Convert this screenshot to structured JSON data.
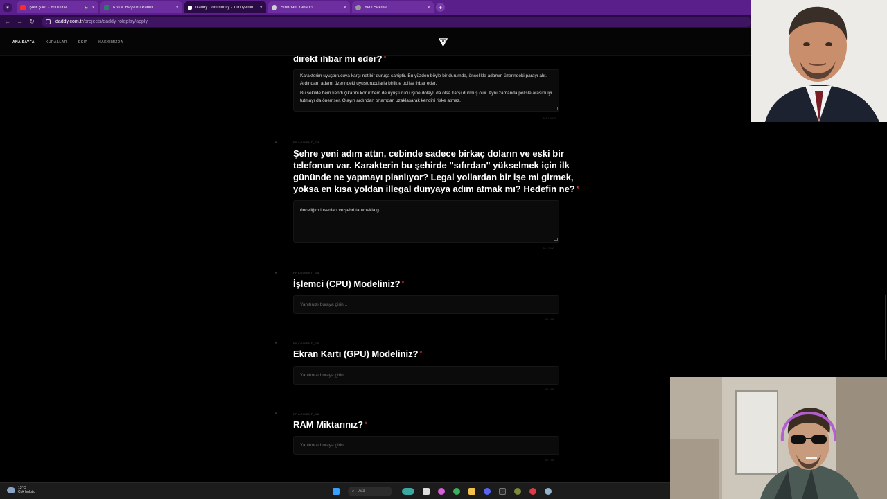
{
  "browser": {
    "tabs": [
      {
        "title": "Şikir Şıkır - YouTube",
        "fav_color": "#ff2b2b",
        "audio": true
      },
      {
        "title": "KNGL Başvuru Paneli",
        "fav_color": "#2e7d6a",
        "audio": false
      },
      {
        "title": "Daddy Community - Türkiye'nin",
        "fav_color": "#ffffff",
        "audio": false
      },
      {
        "title": "Sınırdaki Yabancı",
        "fav_color": "#cfcfcf",
        "audio": false
      },
      {
        "title": "Yeni Sekme",
        "fav_color": "#9a9a9a",
        "audio": false
      }
    ],
    "active_tab": 2,
    "url_host": "daddy.com.tr",
    "url_path": "/projects/daddy-roleplay/apply"
  },
  "site": {
    "nav": [
      "ANA SAYFA",
      "KURALLAR",
      "EKİP",
      "HAKKIMIZDA"
    ],
    "active_nav": 0
  },
  "form": {
    "q_prev_title_tail": "direkt ihbar mı eder?",
    "q_prev_answer_p1": "Karakterim uyuşturucuya karşı net bir duruşa sahiptir. Bu yüzden böyle bir durumda, öncelikle adamın üzerindeki parayı alır. Ardından, adamı üzerindeki uyuşturucularla birlikte polise ihbar eder.",
    "q_prev_answer_p2": "Bu şekilde hem kendi çıkarını korur hem de uyuşturucu işine dolaylı da olsa karşı durmuş olur. Aynı zamanda polisle arasını iyi tutmayı da önemser. Olayın ardından ortamdan uzaklaşarak kendini riske atmaz.",
    "q_prev_counter": "361 / 1000",
    "q13_fragment": "FRAGMENT_13",
    "q13_title": "Şehre yeni adım attın, cebinde sadece birkaç doların ve eski bir telefonun var. Karakterin bu şehirde \"sıfırdan\" yükselmek için ilk gününde ne yapmayı planlıyor? Legal yollardan bir işe mi girmek, yoksa en kısa yoldan illegal dünyaya adım atmak mı? Hedefin ne?",
    "q13_answer": "önceliğim insanları ve şehri tanımakla g",
    "q13_counter": "40 / 1000",
    "q14_fragment": "FRAGMENT_14",
    "q14_title": "İşlemci (CPU) Modeliniz?",
    "q15_fragment": "FRAGMENT_15",
    "q15_title": "Ekran Kartı (GPU) Modeliniz?",
    "q16_fragment": "FRAGMENT_16",
    "q16_title": "RAM Miktarınız?",
    "placeholder": "Yanıtınızı buraya girin...",
    "short_counter": "0 / 100",
    "required_mark": "*"
  },
  "taskbar": {
    "temp": "13°C",
    "condition": "Çok bulutlu",
    "search_label": "Ara"
  },
  "colors": {
    "tabbar": "#5b1f8c",
    "addressbar": "#2a0b45",
    "required": "#d23a3a"
  }
}
